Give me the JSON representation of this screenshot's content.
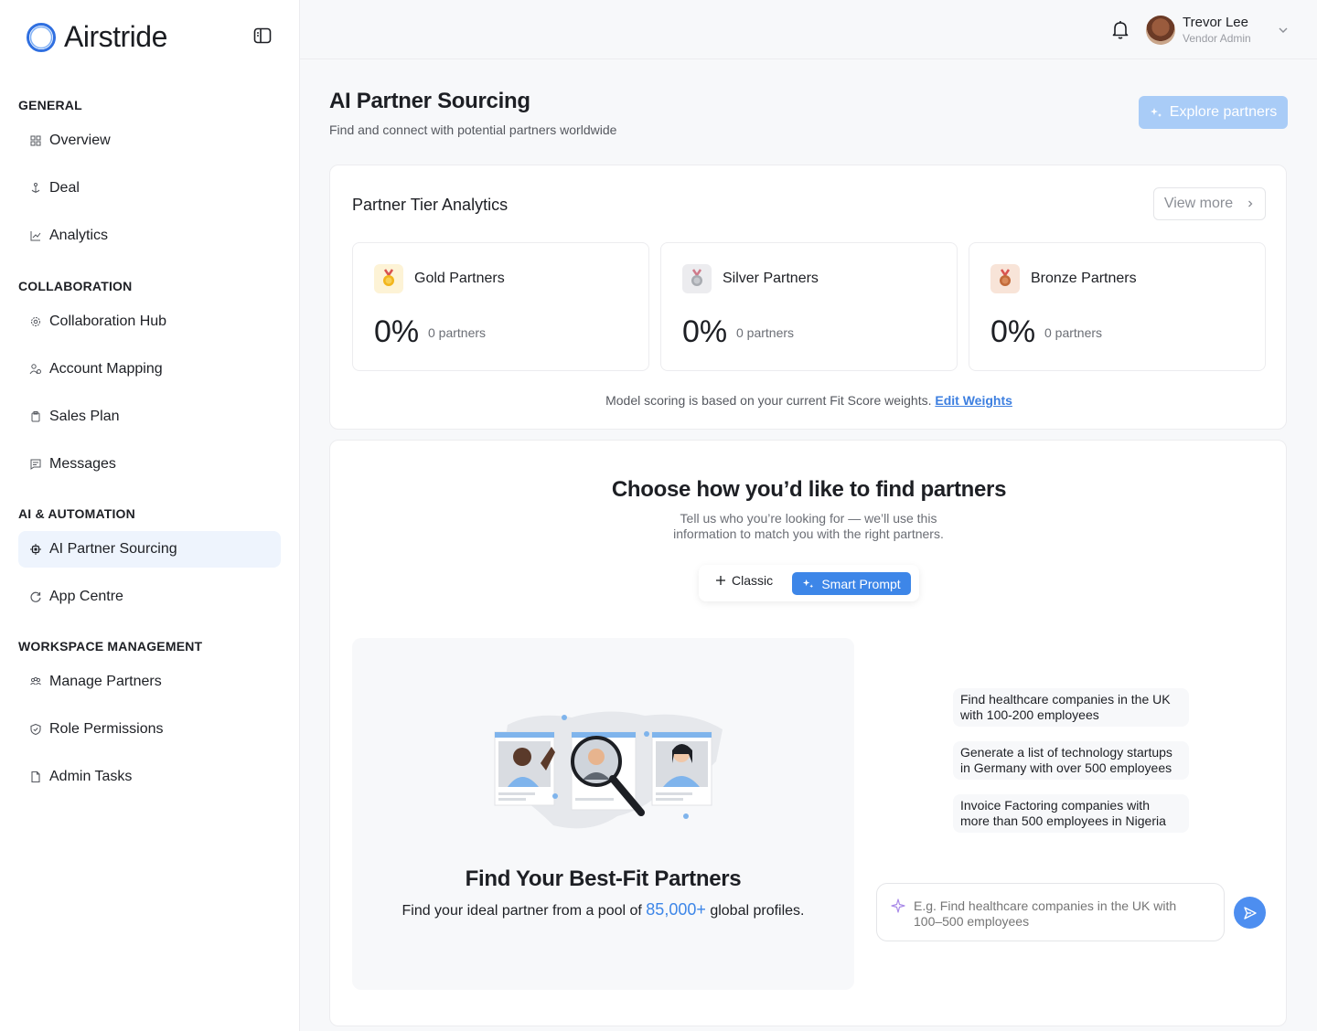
{
  "brand": {
    "name": "Airstride"
  },
  "sidebar": {
    "sections": [
      {
        "title": "GENERAL"
      },
      {
        "title": "COLLABORATION"
      },
      {
        "title": "AI & AUTOMATION"
      },
      {
        "title": "WORKSPACE MANAGEMENT"
      }
    ],
    "items": [
      {
        "label": "Overview",
        "icon": "grid-icon"
      },
      {
        "label": "Deal",
        "icon": "anchor-icon"
      },
      {
        "label": "Analytics",
        "icon": "chart-line-icon"
      },
      {
        "label": "Collaboration Hub",
        "icon": "gear-people-icon"
      },
      {
        "label": "Account Mapping",
        "icon": "users-icon"
      },
      {
        "label": "Sales Plan",
        "icon": "clipboard-icon"
      },
      {
        "label": "Messages",
        "icon": "message-icon"
      },
      {
        "label": "AI Partner Sourcing",
        "icon": "chip-icon",
        "active": true
      },
      {
        "label": "App Centre",
        "icon": "refresh-icon"
      },
      {
        "label": "Manage Partners",
        "icon": "people-icon"
      },
      {
        "label": "Role Permissions",
        "icon": "shield-icon"
      },
      {
        "label": "Admin Tasks",
        "icon": "file-icon"
      }
    ]
  },
  "header": {
    "user_name": "Trevor Lee",
    "user_role": "Vendor Admin"
  },
  "page": {
    "title": "AI Partner Sourcing",
    "subtitle": "Find and connect with potential partners worldwide",
    "explore_label": "Explore partners"
  },
  "analytics": {
    "title": "Partner Tier Analytics",
    "view_more": "View more",
    "tiers": [
      {
        "name": "Gold Partners",
        "pct": "0%",
        "count": "0 partners",
        "color": "#f2b51c"
      },
      {
        "name": "Silver Partners",
        "pct": "0%",
        "count": "0 partners",
        "color": "#a8abb1"
      },
      {
        "name": "Bronze Partners",
        "pct": "0%",
        "count": "0 partners",
        "color": "#c26a3a"
      }
    ],
    "note": "Model scoring is based on your current Fit Score weights.",
    "edit_link": "Edit Weights"
  },
  "finder": {
    "title": "Choose how you’d like to find partners",
    "subtitle": "Tell us who you’re looking for — we’ll use this information to match you with the right partners.",
    "mode_classic": "Classic",
    "mode_smart": "Smart Prompt",
    "illus_title": "Find Your Best-Fit Partners",
    "illus_sub_pre": "Find your ideal partner from a pool of",
    "illus_highlight": "85,000+",
    "illus_sub_post": "global profiles.",
    "suggestions": [
      "Find healthcare companies in the UK with 100-200 employees",
      "Generate a list of technology startups in Germany with over 500 employees",
      "Invoice Factoring companies with more than 500 employees in Nigeria"
    ],
    "prompt_placeholder": "E.g. Find healthcare companies in the UK with 100–500 employees"
  },
  "colors": {
    "accent": "#3d86e8",
    "active_bg": "#eef4fd",
    "explore_bg": "#a9ccf7"
  }
}
